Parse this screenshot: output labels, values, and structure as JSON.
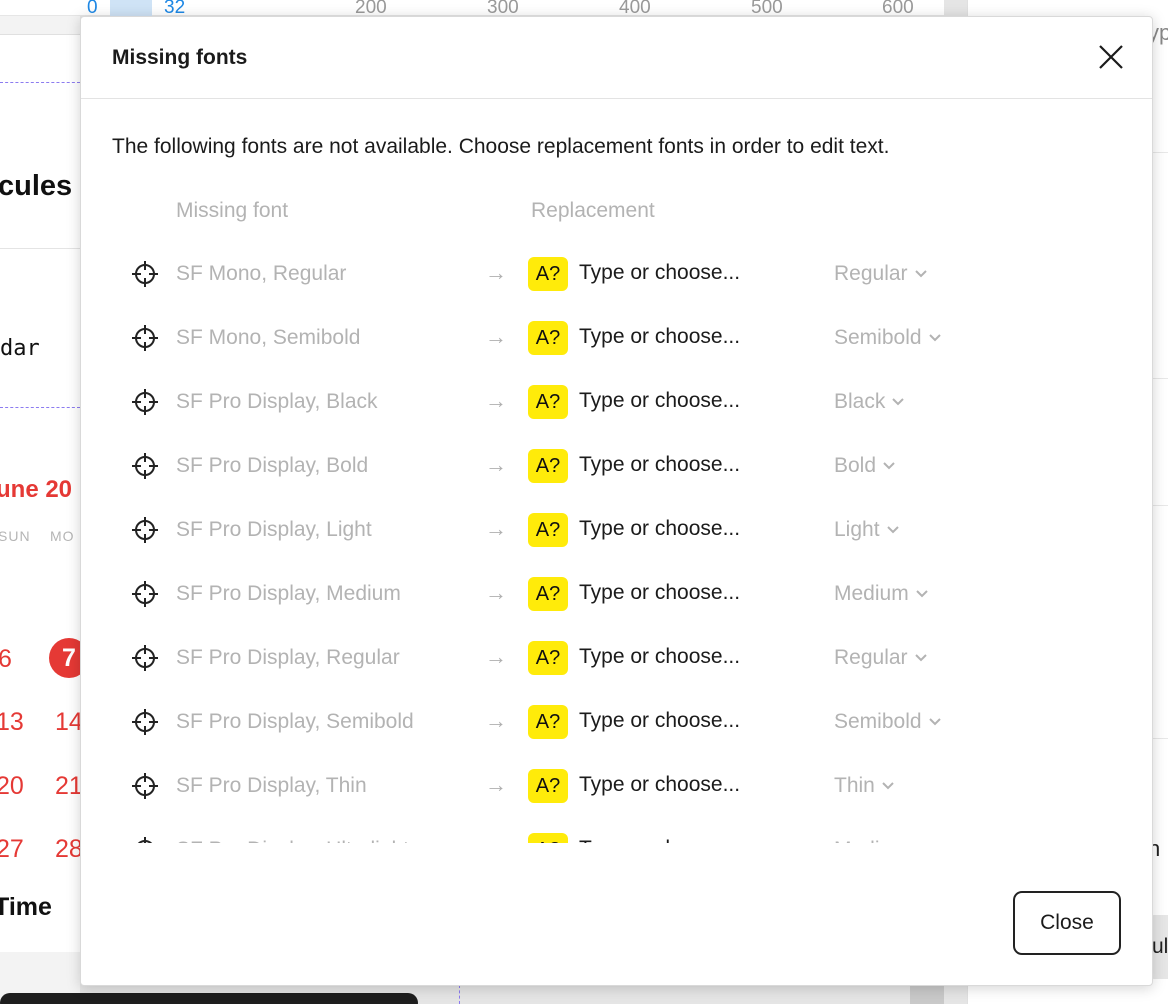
{
  "background": {
    "ruler": {
      "labels": [
        "0",
        "32",
        "200",
        "300",
        "400",
        "500",
        "600"
      ]
    },
    "title_fragment": "cules",
    "mono_fragment": "dar",
    "calendar": {
      "month": "une 20",
      "dow": [
        "SUN",
        "MO"
      ],
      "days": [
        "6",
        "13",
        "14",
        "20",
        "21",
        "27",
        "28"
      ],
      "today": "7"
    },
    "time_fragment": "Time",
    "right_panel": {
      "top_text": "yp",
      "mid_text": "n",
      "bottom_text": "ula"
    }
  },
  "modal": {
    "title": "Missing fonts",
    "description": "The following fonts are not available. Choose replacement fonts in order to edit text.",
    "columns": {
      "missing": "Missing font",
      "replacement": "Replacement"
    },
    "badge_label": "A?",
    "arrow": "→",
    "rows": [
      {
        "font": "SF Mono, Regular",
        "placeholder": "Type or choose...",
        "style": "Regular"
      },
      {
        "font": "SF Mono, Semibold",
        "placeholder": "Type or choose...",
        "style": "Semibold"
      },
      {
        "font": "SF Pro Display, Black",
        "placeholder": "Type or choose...",
        "style": "Black"
      },
      {
        "font": "SF Pro Display, Bold",
        "placeholder": "Type or choose...",
        "style": "Bold"
      },
      {
        "font": "SF Pro Display, Light",
        "placeholder": "Type or choose...",
        "style": "Light"
      },
      {
        "font": "SF Pro Display, Medium",
        "placeholder": "Type or choose...",
        "style": "Medium"
      },
      {
        "font": "SF Pro Display, Regular",
        "placeholder": "Type or choose...",
        "style": "Regular"
      },
      {
        "font": "SF Pro Display, Semibold",
        "placeholder": "Type or choose...",
        "style": "Semibold"
      },
      {
        "font": "SF Pro Display, Thin",
        "placeholder": "Type or choose...",
        "style": "Thin"
      },
      {
        "font": "SF Pro Display, Ultralight",
        "placeholder": "Type or choose...",
        "style": "Medium"
      }
    ],
    "close_button": "Close"
  },
  "colors": {
    "badge": "#ffeb0a",
    "accent_red": "#e53935",
    "ruler_blue": "#1e88e5"
  }
}
